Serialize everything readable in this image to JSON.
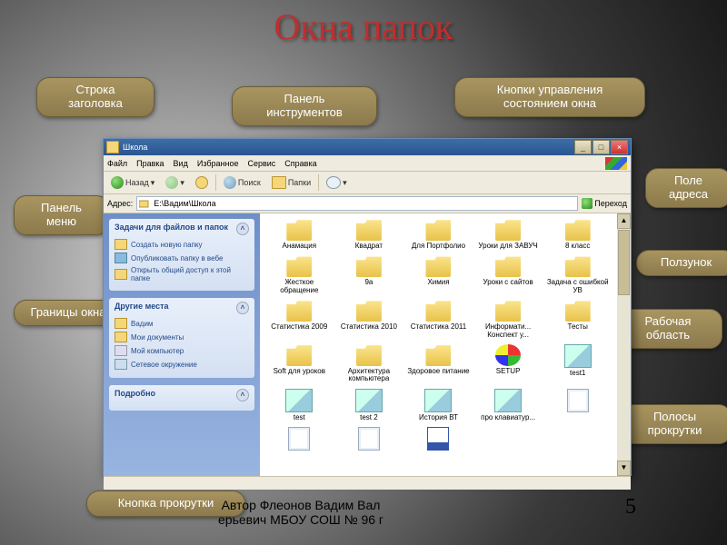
{
  "slide": {
    "title": "Окна папок",
    "page_num": "5",
    "author_line1": "Автор Флеонов Вадим Вал",
    "author_line2": "ерьевич МБОУ СОШ № 96 г"
  },
  "callouts": {
    "title_row": "Строка заголовка",
    "toolbar": "Панель инструментов",
    "ctrl_buttons": "Кнопки управления состоянием окна",
    "menu": "Панель меню",
    "address": "Поле адреса",
    "slider": "Ползунок",
    "borders": "Границы окна",
    "workarea": "Рабочая область",
    "scrollbars": "Полосы прокрутки",
    "scroll_btn": "Кнопка прокрутки"
  },
  "window": {
    "title": "Школа",
    "min": "_",
    "max": "□",
    "close": "×",
    "menu": [
      "Файл",
      "Правка",
      "Вид",
      "Избранное",
      "Сервис",
      "Справка"
    ],
    "tb_back": "Назад",
    "tb_search": "Поиск",
    "tb_folders": "Папки",
    "addr_label": "Адрес:",
    "addr_value": "E:\\Вадим\\Школа",
    "go": "Переход",
    "tasks_header": "Задачи для файлов и папок",
    "tasks_items": [
      "Создать новую папку",
      "Опубликовать папку в вебе",
      "Открыть общий доступ к этой папке"
    ],
    "places_header": "Другие места",
    "places_items": [
      "Вадим",
      "Мои документы",
      "Мой компьютер",
      "Сетевое окружение"
    ],
    "details_header": "Подробно",
    "arr_up": "▲",
    "arr_down": "▼"
  },
  "items": [
    {
      "name": "Анамация",
      "t": "folder"
    },
    {
      "name": "Квадрат",
      "t": "folder"
    },
    {
      "name": "Для Портфолио",
      "t": "folder"
    },
    {
      "name": "Уроки для ЗАВУЧ",
      "t": "folder"
    },
    {
      "name": "8 класс",
      "t": "folder"
    },
    {
      "name": "Жесткое обращение",
      "t": "folder",
      "wide": true
    },
    {
      "name": "9а",
      "t": "folder"
    },
    {
      "name": "Химия",
      "t": "folder"
    },
    {
      "name": "Уроки с сайтов",
      "t": "folder"
    },
    {
      "name": "Задача с ошибкой УВ",
      "t": "folder"
    },
    {
      "name": "Статистика 2009",
      "t": "folder"
    },
    {
      "name": "Статистика 2010",
      "t": "folder"
    },
    {
      "name": "Статистика 2011",
      "t": "folder"
    },
    {
      "name": "Информати... Конспект у...",
      "t": "folder"
    },
    {
      "name": "Тесты",
      "t": "folder"
    },
    {
      "name": "Soft для уроков",
      "t": "folder"
    },
    {
      "name": "Архитектура компьютера",
      "t": "folder"
    },
    {
      "name": "Здоровое питание",
      "t": "folder"
    },
    {
      "name": "SETUP",
      "t": "setup"
    },
    {
      "name": "test1",
      "t": "wiz"
    },
    {
      "name": "test",
      "t": "wiz"
    },
    {
      "name": "test 2",
      "t": "wiz"
    },
    {
      "name": "История ВТ",
      "t": "wiz"
    },
    {
      "name": "про клавиатур...",
      "t": "wiz"
    },
    {
      "name": "",
      "t": "doc"
    },
    {
      "name": "",
      "t": "doc"
    },
    {
      "name": "",
      "t": "doc"
    },
    {
      "name": "",
      "t": "word"
    }
  ]
}
